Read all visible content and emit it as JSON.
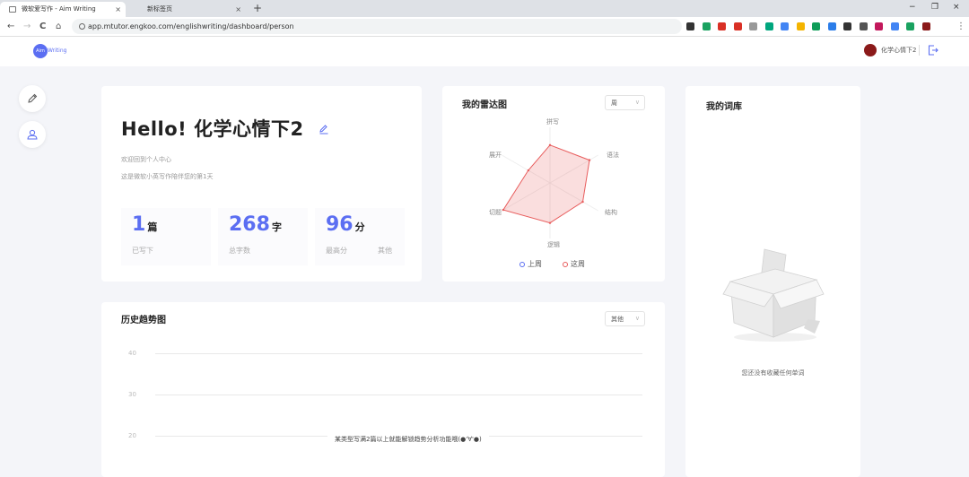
{
  "browser": {
    "tabs": [
      {
        "title": "微软爱写作 - Aim Writing",
        "close": "×"
      },
      {
        "title": "新标签页",
        "close": "×"
      }
    ],
    "new_tab": "+",
    "window_controls": [
      "−",
      "❐",
      "×"
    ],
    "url": "app.mtutor.engkoo.com/englishwriting/dashboard/person",
    "nav": [
      "←",
      "→",
      "C",
      "⌂"
    ],
    "ext_colors": [
      "#333333",
      "#1aa260",
      "#d93025",
      "#d93025",
      "#999999",
      "#00a67e",
      "#4285f4",
      "#f4b400",
      "#0f9d58",
      "#2b7de9",
      "#333333",
      "#555555",
      "#c2185b",
      "#4285f4",
      "#1aa260",
      "#8b1a1a"
    ],
    "menu": "⋮"
  },
  "header": {
    "logo_mark": "Aim",
    "logo_text": "Writing",
    "username": "化学心情下2",
    "colors": {
      "accent": "#5b6ef2"
    }
  },
  "sidebar": {
    "buttons": [
      {
        "icon": "pencil-icon"
      },
      {
        "icon": "user-icon"
      }
    ]
  },
  "profile": {
    "greeting": "Hello! 化学心情下2",
    "welcome": "欢迎回到个人中心",
    "days_text": "这是微软小英写作陪伴您的第1天",
    "stats": [
      {
        "value": "1",
        "unit": "篇",
        "label": "已写下"
      },
      {
        "value": "268",
        "unit": "字",
        "label": "总字数"
      },
      {
        "value": "96",
        "unit": "分",
        "label": "最高分",
        "extra": "其他"
      }
    ]
  },
  "radar": {
    "title": "我的雷达图",
    "period_select": "周",
    "chevron": "∨",
    "axes": [
      "拼写",
      "语法",
      "结构",
      "逻辑",
      "切题",
      "展开"
    ],
    "legend": [
      {
        "label": "上周",
        "color": "#5b6ef2"
      },
      {
        "label": "这周",
        "color": "#e85c5c"
      }
    ]
  },
  "history": {
    "title": "历史趋势图",
    "filter_select": "其他",
    "chevron": "∨",
    "yticks": [
      "40",
      "30",
      "20"
    ],
    "message": "某类型写满2篇以上就能解锁趋势分析功能哦(●'∀'●)"
  },
  "vocab": {
    "title": "我的词库",
    "empty_text": "您还没有收藏任何单词"
  },
  "chart_data": {
    "type": "radar",
    "categories": [
      "拼写",
      "语法",
      "结构",
      "逻辑",
      "切题",
      "展开"
    ],
    "range": [
      0,
      100
    ],
    "series": [
      {
        "name": "这周",
        "values": [
          68,
          82,
          68,
          72,
          97,
          45
        ]
      }
    ]
  }
}
